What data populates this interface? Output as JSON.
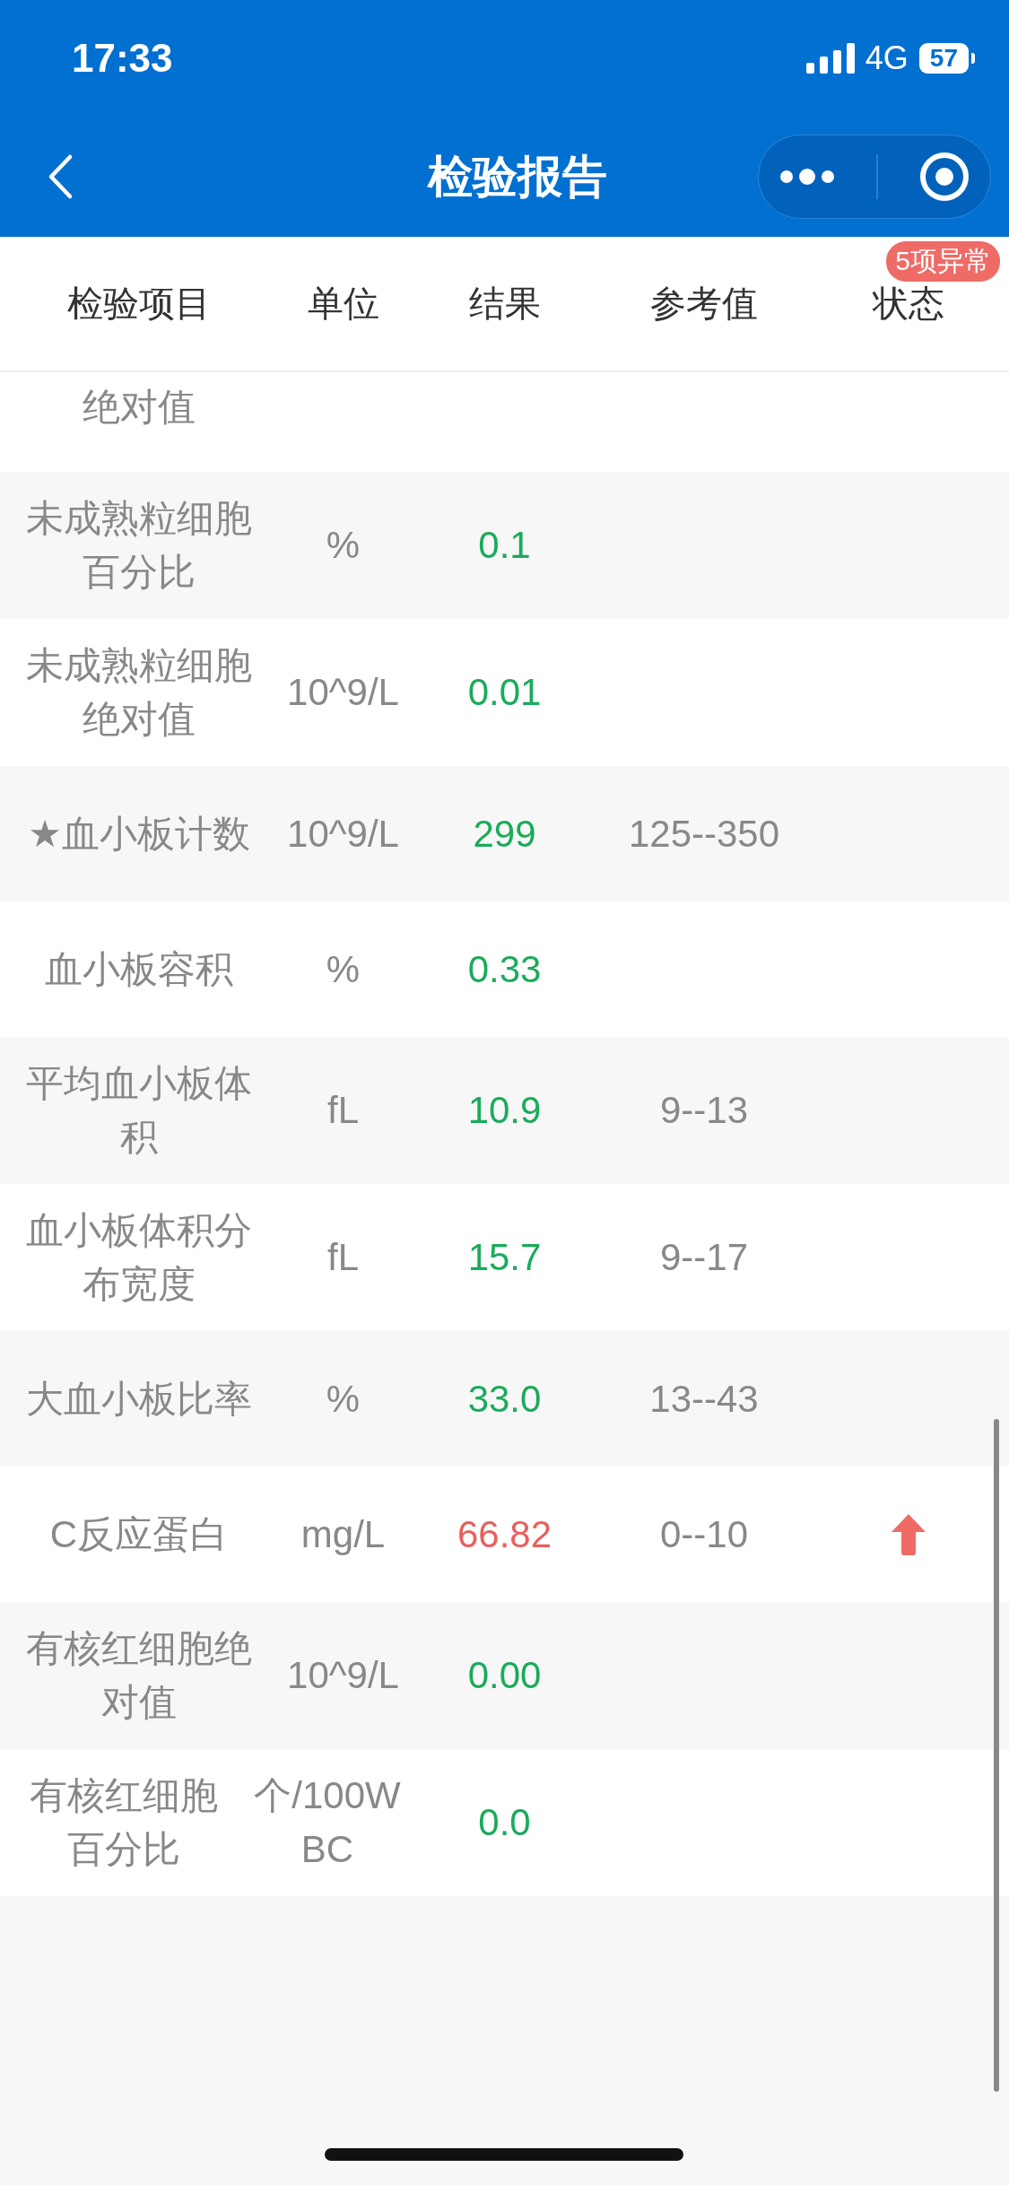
{
  "status_bar": {
    "time": "17:33",
    "network": "4G",
    "battery": "57"
  },
  "nav": {
    "title": "检验报告"
  },
  "table": {
    "columns": [
      "检验项目",
      "单位",
      "结果",
      "参考值",
      "状态"
    ],
    "badge": "5项异常",
    "rows": [
      {
        "name": "绝对值"
      },
      {
        "name": "未成熟粒细胞百分比",
        "unit": "%",
        "result": "0.1",
        "high": false
      },
      {
        "name": "未成熟粒细胞绝对值",
        "unit": "10^9/L",
        "result": "0.01",
        "high": false
      },
      {
        "name": "★血小板计数",
        "unit": "10^9/L",
        "result": "299",
        "reference": "125--350",
        "high": false
      },
      {
        "name": "血小板容积",
        "unit": "%",
        "result": "0.33",
        "high": false
      },
      {
        "name": "平均血小板体积",
        "unit": "fL",
        "result": "10.9",
        "reference": "9--13",
        "high": false
      },
      {
        "name": "血小板体积分布宽度",
        "unit": "fL",
        "result": "15.7",
        "reference": "9--17",
        "high": false
      },
      {
        "name": "大血小板比率",
        "unit": "%",
        "result": "33.0",
        "reference": "13--43",
        "high": false
      },
      {
        "name": "C反应蛋白",
        "unit": "mg/L",
        "result": "66.82",
        "reference": "0--10",
        "high": true
      },
      {
        "name": "有核红细胞绝对值",
        "unit": "10^9/L",
        "result": "0.00",
        "high": false
      },
      {
        "name": "有核红细胞百分比",
        "unit": "个/100WBC",
        "result": "0.0",
        "high": false
      }
    ]
  }
}
